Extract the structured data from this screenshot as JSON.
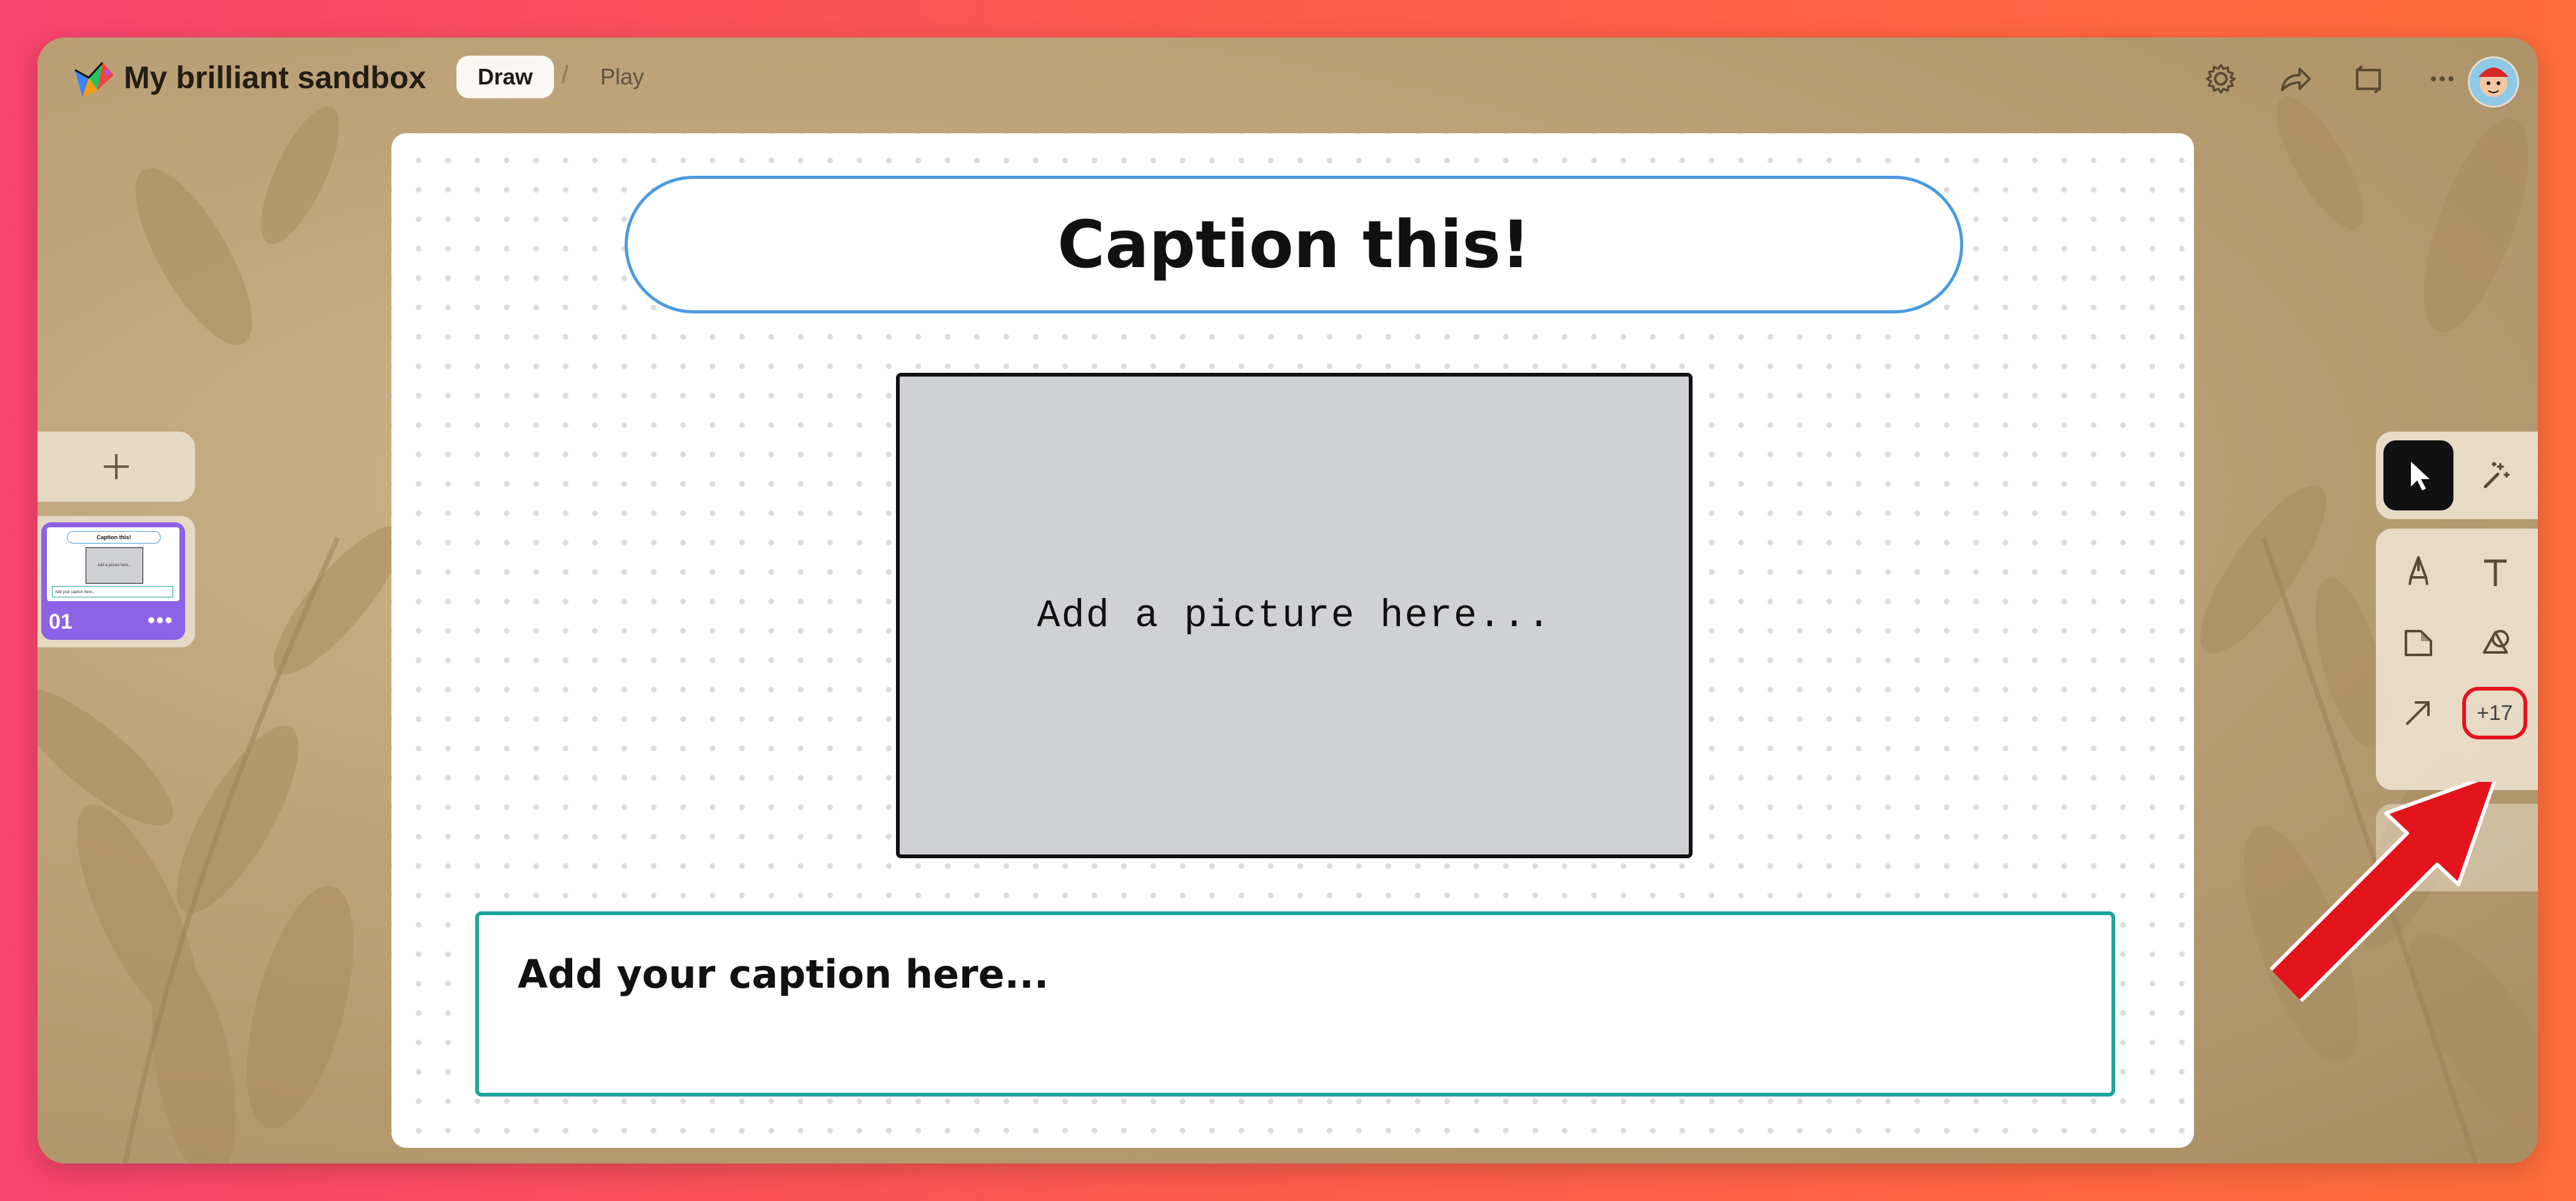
{
  "app": {
    "title": "My brilliant sandbox",
    "tabs": {
      "draw": "Draw",
      "separator": "/",
      "play": "Play"
    }
  },
  "header_icons": [
    "settings-icon",
    "share-icon",
    "present-icon",
    "more-icon",
    "avatar"
  ],
  "canvas": {
    "title": "Caption this!",
    "picture_placeholder": "Add a picture here...",
    "caption_placeholder": "Add your caption here..."
  },
  "slides": {
    "add_label": "+",
    "items": [
      {
        "number": "01",
        "menu": "•••",
        "preview_title": "Caption this!",
        "preview_picture": "Add a picture here...",
        "preview_caption": "Add your caption here..."
      }
    ]
  },
  "toolbar": {
    "tools": [
      "select-tool",
      "magic-tool",
      "pen-tool",
      "text-tool",
      "sticky-note-tool",
      "shapes-tool",
      "arrow-tool"
    ],
    "more_label": "+17"
  },
  "colors": {
    "background_gradient": [
      "#f7436d",
      "#ff6d3a"
    ],
    "title_border": "#4a9be0",
    "caption_border": "#1aa699",
    "slide_accent": "#8c62e6",
    "highlight": "#e3141b"
  }
}
